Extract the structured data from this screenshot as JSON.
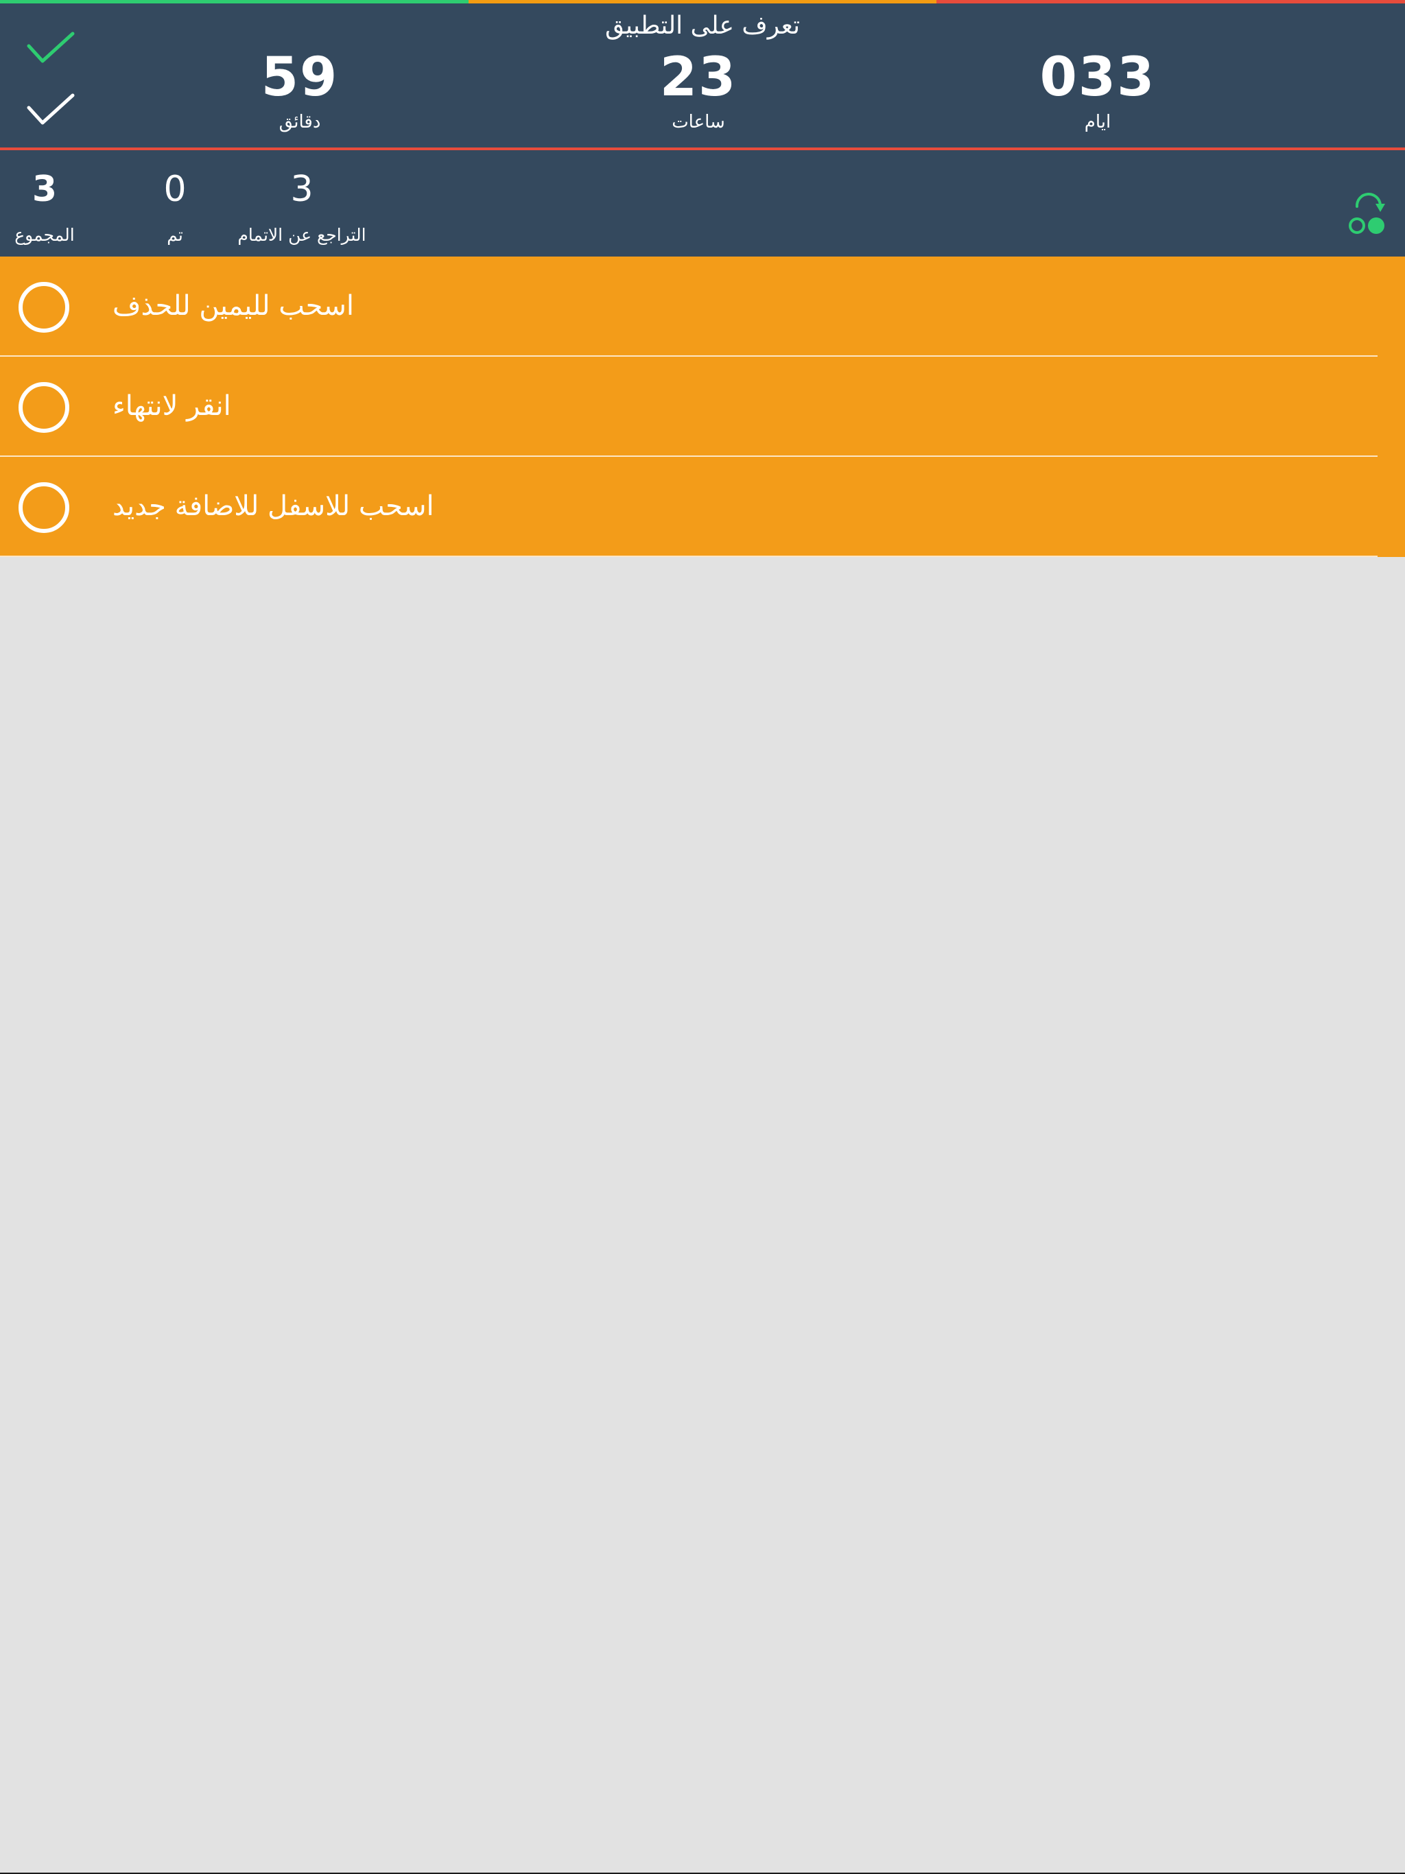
{
  "colors": {
    "header_bg": "#34495e",
    "task_bg": "#f39c19",
    "list_bg": "#e2e2e2",
    "accent_green": "#2ecc71",
    "accent_red": "#e74c3c",
    "strip": [
      "#2ecc71",
      "#f39c12",
      "#e74c3c"
    ]
  },
  "header": {
    "title": "تعرف على التطبيق",
    "icons": {
      "top": "checkmark-icon",
      "bottom": "checkmark-icon"
    },
    "countdown": {
      "minutes": {
        "value": "59",
        "label": "دقائق"
      },
      "hours": {
        "value": "23",
        "label": "ساعات"
      },
      "days": {
        "value": "033",
        "label": "ايام"
      }
    }
  },
  "stats": {
    "total": {
      "value": "3",
      "label": "المجموع"
    },
    "done": {
      "value": "0",
      "label": "تم"
    },
    "undo": {
      "value": "3",
      "label": "التراجع عن الاتمام"
    },
    "icon": "undo-icon"
  },
  "tasks": [
    {
      "text": "اسحب لليمين للحذف"
    },
    {
      "text": "انقر لانتهاء"
    },
    {
      "text": "اسحب للاسفل للاضافة جديد"
    }
  ]
}
